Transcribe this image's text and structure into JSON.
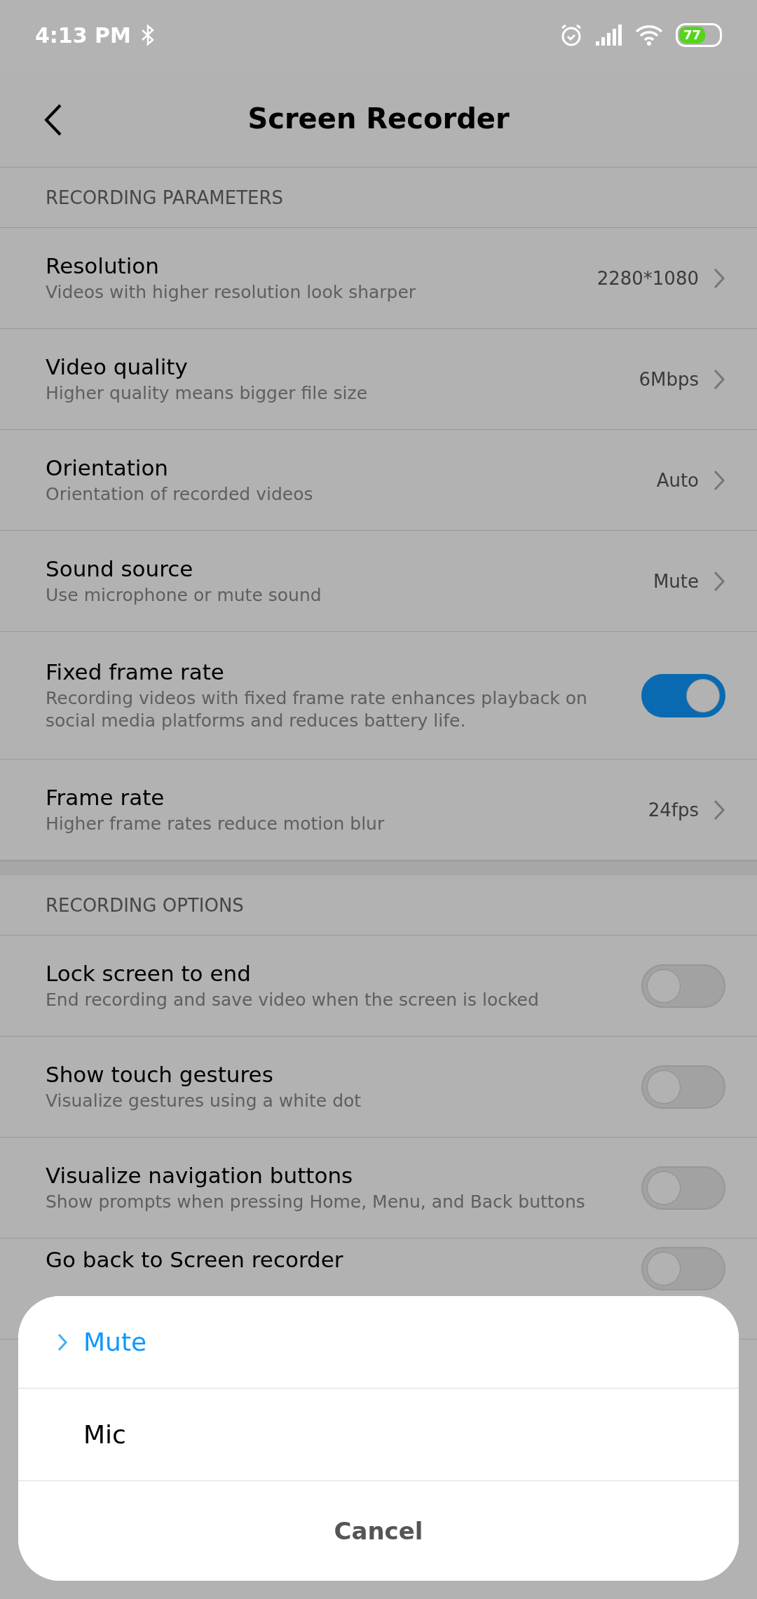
{
  "status_bar": {
    "time": "4:13 PM",
    "battery": "77"
  },
  "header": {
    "title": "Screen Recorder"
  },
  "sections": [
    {
      "title": "RECORDING PARAMETERS",
      "items": [
        {
          "kind": "link",
          "title": "Resolution",
          "subtitle": "Videos with higher resolution look sharper",
          "value": "2280*1080"
        },
        {
          "kind": "link",
          "title": "Video quality",
          "subtitle": "Higher quality means bigger file size",
          "value": "6Mbps"
        },
        {
          "kind": "link",
          "title": "Orientation",
          "subtitle": "Orientation of recorded videos",
          "value": "Auto"
        },
        {
          "kind": "link",
          "title": "Sound source",
          "subtitle": "Use microphone or mute sound",
          "value": "Mute"
        },
        {
          "kind": "toggle",
          "title": "Fixed frame rate",
          "subtitle": "Recording videos with fixed frame rate enhances playback on social media platforms and reduces battery life.",
          "on": true
        },
        {
          "kind": "link",
          "title": "Frame rate",
          "subtitle": "Higher frame rates reduce motion blur",
          "value": "24fps"
        }
      ]
    },
    {
      "title": "RECORDING OPTIONS",
      "items": [
        {
          "kind": "toggle",
          "title": "Lock screen to end",
          "subtitle": "End recording and save video when the screen is locked",
          "on": false
        },
        {
          "kind": "toggle",
          "title": "Show touch gestures",
          "subtitle": "Visualize gestures using a white dot",
          "on": false
        },
        {
          "kind": "toggle",
          "title": "Visualize navigation buttons",
          "subtitle": "Show prompts when pressing Home, Menu, and Back buttons",
          "on": false
        },
        {
          "kind": "toggle",
          "title": "Go back to Screen recorder",
          "on": false
        }
      ]
    }
  ],
  "sheet": {
    "options": [
      {
        "label": "Mute",
        "selected": true
      },
      {
        "label": "Mic",
        "selected": false
      }
    ],
    "cancel": "Cancel"
  }
}
